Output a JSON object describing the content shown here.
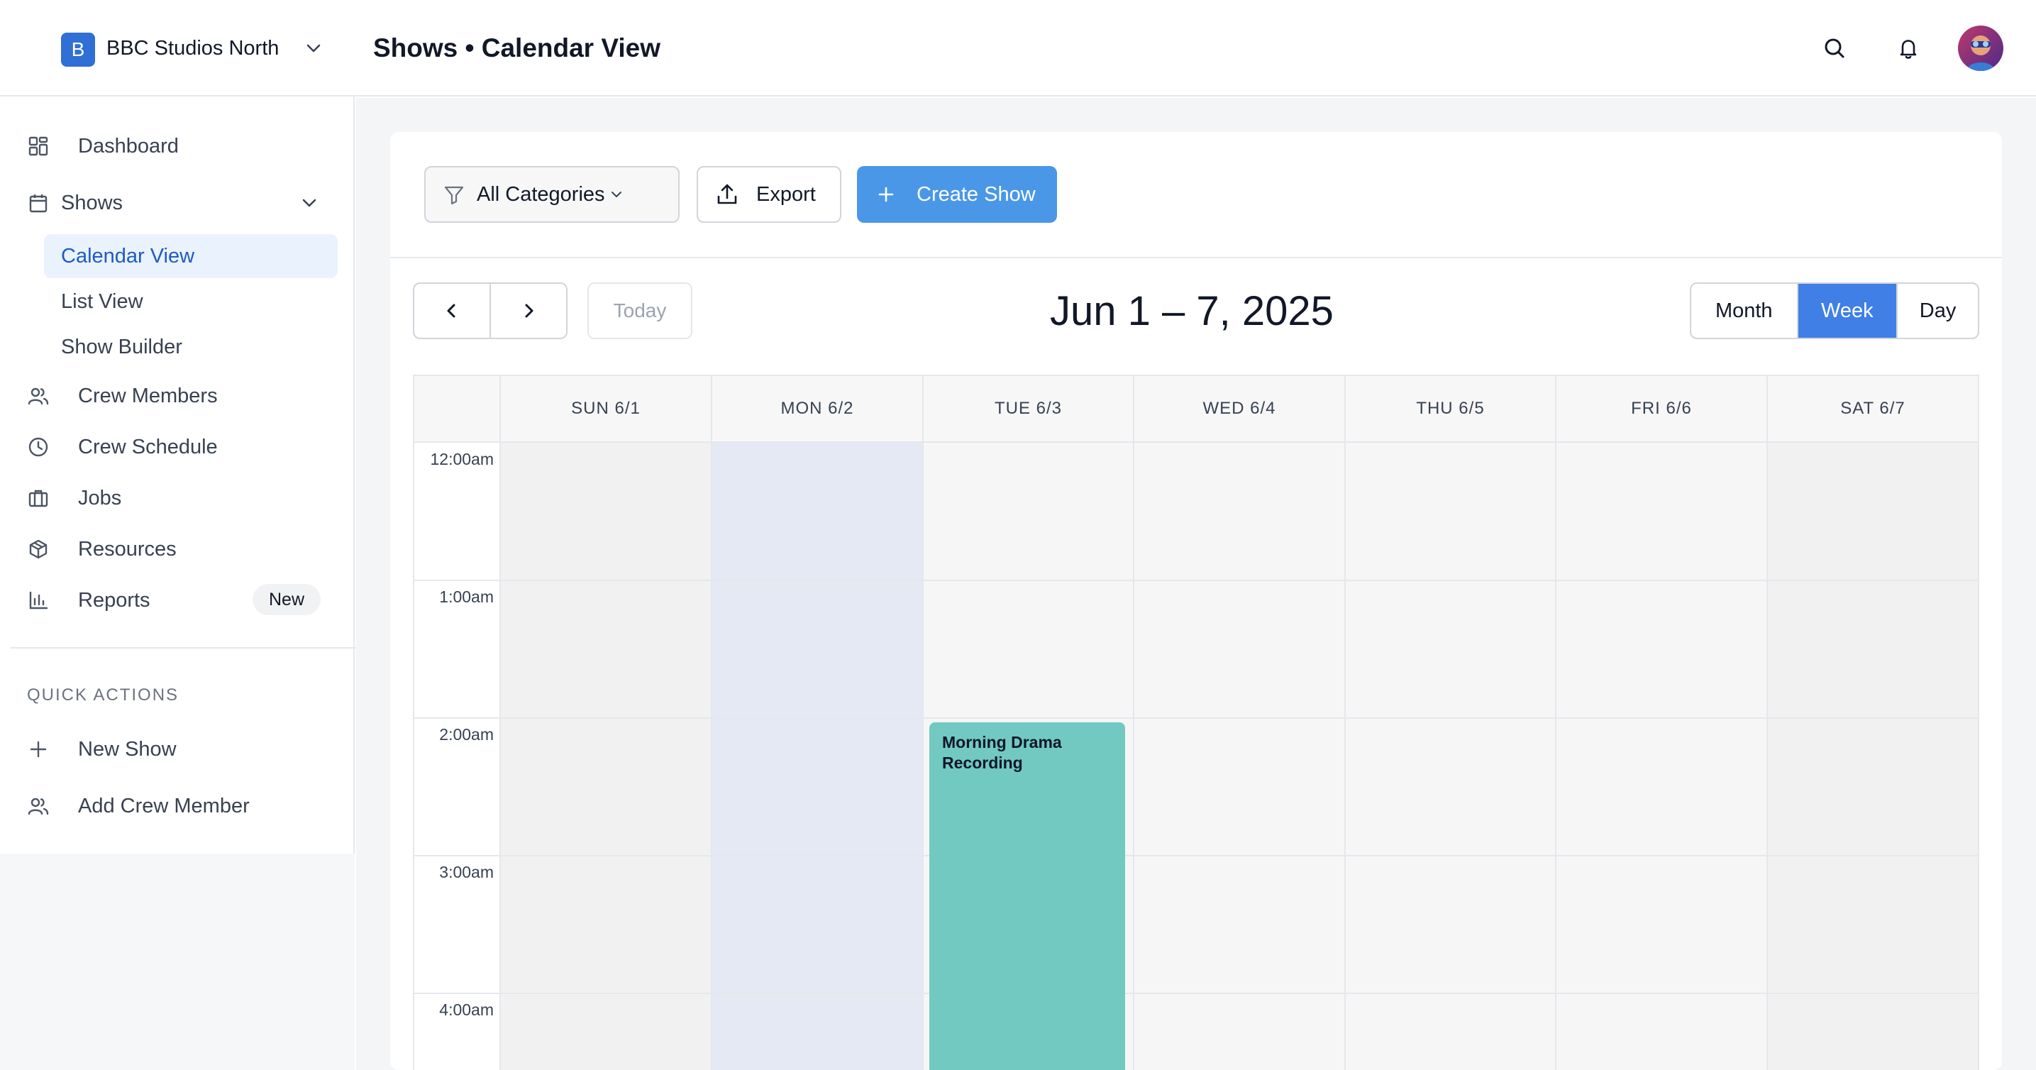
{
  "header": {
    "org_initial": "B",
    "org_name": "BBC Studios North",
    "page_title": "Shows • Calendar View",
    "icons": [
      "search-icon",
      "bell-icon",
      "avatar"
    ]
  },
  "sidebar": {
    "items": [
      {
        "label": "Dashboard",
        "icon": "dashboard-icon"
      },
      {
        "label": "Shows",
        "icon": "calendar-icon",
        "expanded": true
      },
      {
        "label": "Crew Members",
        "icon": "users-icon"
      },
      {
        "label": "Crew Schedule",
        "icon": "clock-icon"
      },
      {
        "label": "Jobs",
        "icon": "briefcase-icon"
      },
      {
        "label": "Resources",
        "icon": "box-icon"
      },
      {
        "label": "Reports",
        "icon": "bar-chart-icon",
        "badge": "New"
      }
    ],
    "shows_sub": [
      {
        "label": "Calendar View",
        "active": true
      },
      {
        "label": "List View"
      },
      {
        "label": "Show Builder"
      }
    ],
    "quick_actions_title": "QUICK ACTIONS",
    "quick_actions": [
      {
        "label": "New Show",
        "icon": "plus-icon"
      },
      {
        "label": "Add Crew Member",
        "icon": "users-icon"
      }
    ]
  },
  "toolbar": {
    "filter_label": "All Categories",
    "export_label": "Export",
    "create_label": "Create Show"
  },
  "calendar": {
    "today_label": "Today",
    "range_title": "Jun 1 – 7, 2025",
    "views": [
      "Month",
      "Week",
      "Day"
    ],
    "active_view": "Week",
    "days": [
      "SUN 6/1",
      "MON 6/2",
      "TUE 6/3",
      "WED 6/4",
      "THU 6/5",
      "FRI 6/6",
      "SAT 6/7"
    ],
    "times": [
      "12:00am",
      "1:00am",
      "2:00am",
      "3:00am",
      "4:00am"
    ],
    "events": [
      {
        "title": "Morning Drama Recording",
        "day": "TUE 6/3",
        "start": "2:00am",
        "color": "#72c9c1"
      }
    ],
    "highlight_day_color": "#e4e9f3",
    "weekend_color": "#f1f1f2",
    "weekday_color": "#f6f6f7"
  },
  "colors": {
    "accent": "#4a97e8",
    "active_nav_bg": "#eaf2fd",
    "active_nav_text": "#1d5bc4",
    "org_badge": "#2f6fd6"
  }
}
